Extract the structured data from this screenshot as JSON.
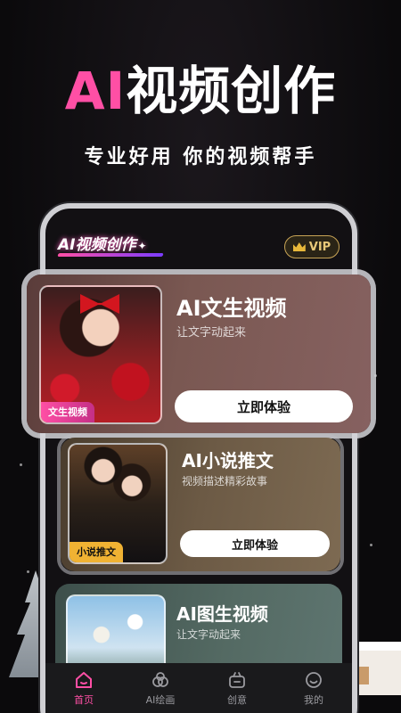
{
  "promo": {
    "headline_ai": "AI",
    "headline_rest": "视频创作",
    "tagline": "专业好用 你的视频帮手"
  },
  "app": {
    "logo": "AI视频创作",
    "vip_label": "VIP"
  },
  "cards": [
    {
      "title": "AI文生视频",
      "subtitle": "让文字动起来",
      "tag": "文生视频",
      "button": "立即体验"
    },
    {
      "title": "AI小说推文",
      "subtitle": "视频描述精彩故事",
      "tag": "小说推文",
      "button": "立即体验"
    },
    {
      "title": "AI图生视频",
      "subtitle": "让文字动起来"
    }
  ],
  "nav": {
    "items": [
      {
        "label": "首页",
        "icon": "home-icon",
        "active": true
      },
      {
        "label": "AI绘画",
        "icon": "palette-icon",
        "active": false
      },
      {
        "label": "创意",
        "icon": "idea-icon",
        "active": false
      },
      {
        "label": "我的",
        "icon": "profile-icon",
        "active": false
      }
    ]
  },
  "colors": {
    "accent_pink": "#ff4fa5",
    "vip_gold": "#e8c878",
    "background": "#0d0b0e"
  }
}
